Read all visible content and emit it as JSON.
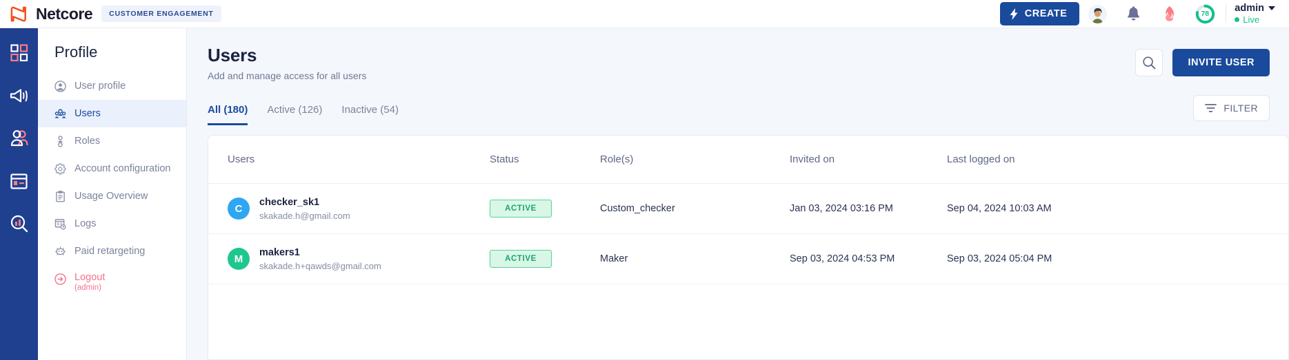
{
  "topbar": {
    "logo_text": "Netcore",
    "logo_icon": "netcore-n-logo",
    "badge": "CUSTOMER ENGAGEMENT",
    "create_label": "CREATE",
    "create_icon": "lightning-bolt-icon",
    "icons": [
      {
        "name": "user-avatar-icon",
        "glyph": "🧑‍🦱"
      },
      {
        "name": "notifications-bell-icon",
        "glyph": "bell"
      },
      {
        "name": "streak-flame-icon",
        "glyph": "flame"
      }
    ],
    "score_ring": {
      "value": "78",
      "color": "#13bf8e",
      "track": "#dfe6f0",
      "percent": 78
    },
    "user": {
      "name": "admin",
      "status": "Live",
      "status_color": "#17c08c"
    }
  },
  "rail": {
    "items": [
      {
        "name": "dashboard-icon",
        "label": "Dashboard"
      },
      {
        "name": "campaigns-megaphone-icon",
        "label": "Campaigns"
      },
      {
        "name": "audience-users-icon",
        "label": "Audience"
      },
      {
        "name": "templates-layout-icon",
        "label": "Templates"
      },
      {
        "name": "analytics-search-icon",
        "label": "Analytics"
      }
    ]
  },
  "profile_nav": {
    "title": "Profile",
    "items": [
      {
        "label": "User profile",
        "icon": "user-circle-icon",
        "active": false
      },
      {
        "label": "Users",
        "icon": "users-group-icon",
        "active": true
      },
      {
        "label": "Roles",
        "icon": "role-person-icon",
        "active": false
      },
      {
        "label": "Account configuration",
        "icon": "gear-account-icon",
        "active": false
      },
      {
        "label": "Usage Overview",
        "icon": "clipboard-icon",
        "active": false
      },
      {
        "label": "Logs",
        "icon": "logs-clock-icon",
        "active": false
      },
      {
        "label": "Paid retargeting",
        "icon": "retargeting-icon",
        "active": false
      }
    ],
    "logout": {
      "label": "Logout",
      "sub": "(admin)",
      "icon": "logout-arrow-icon",
      "color": "#f4728c"
    }
  },
  "main": {
    "title": "Users",
    "subtitle": "Add and manage access for all users",
    "search_icon": "search-icon",
    "invite_label": "INVITE USER",
    "filter_label": "FILTER",
    "filter_icon": "filter-icon",
    "tabs": [
      {
        "label": "All (180)",
        "active": true
      },
      {
        "label": "Active (126)",
        "active": false
      },
      {
        "label": "Inactive (54)",
        "active": false
      }
    ],
    "table": {
      "columns": [
        "Users",
        "Status",
        "Role(s)",
        "Invited on",
        "Last logged on"
      ],
      "rows": [
        {
          "initial": "C",
          "avatar_color": "#2ea7f2",
          "name": "checker_sk1",
          "email": "skakade.h@gmail.com",
          "status": "ACTIVE",
          "role": "Custom_checker",
          "invited_on": "Jan 03, 2024 03:16 PM",
          "last_logged_on": "Sep 04, 2024 10:03 AM"
        },
        {
          "initial": "M",
          "avatar_color": "#1ec88d",
          "name": "makers1",
          "email": "skakade.h+qawds@gmail.com",
          "status": "ACTIVE",
          "role": "Maker",
          "invited_on": "Sep 03, 2024 04:53 PM",
          "last_logged_on": "Sep 03, 2024 05:04 PM"
        }
      ]
    }
  },
  "colors": {
    "brand_blue": "#1a4a9c",
    "rail_blue": "#1f3f8f",
    "page_bg": "#f4f7fc",
    "accent_orange": "#f1521f",
    "accent_pink": "#f4728c",
    "green": "#17a870"
  }
}
